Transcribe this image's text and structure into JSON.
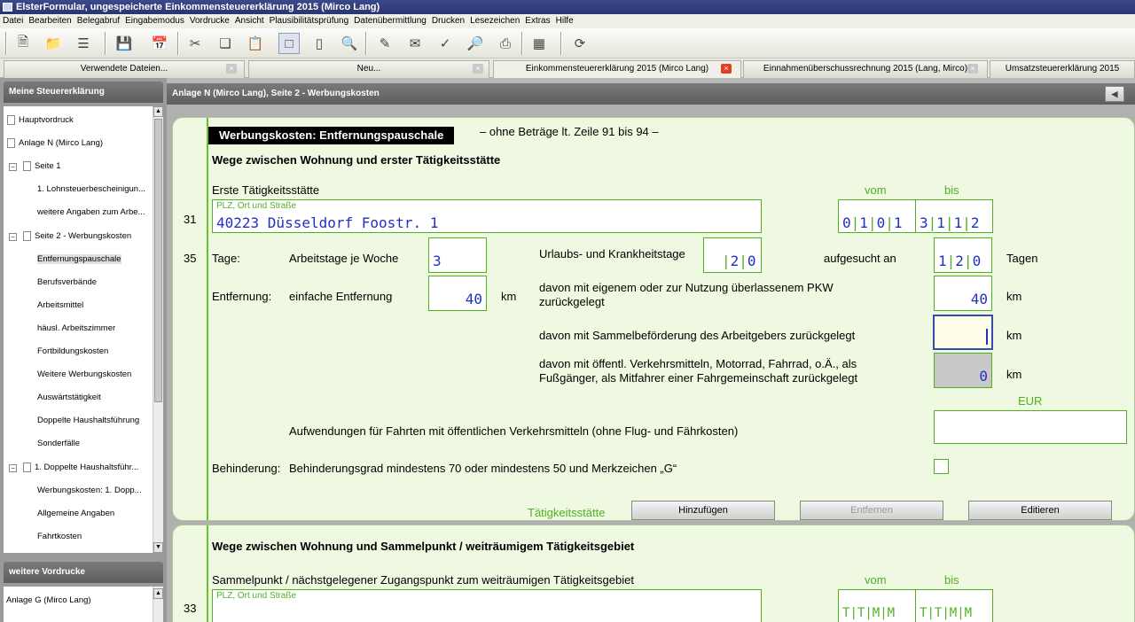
{
  "window": {
    "title": "ElsterFormular, ungespeicherte Einkommensteuererklärung 2015 (Mirco Lang)"
  },
  "menu": [
    "Datei",
    "Bearbeiten",
    "Belegabruf",
    "Eingabemodus",
    "Vordrucke",
    "Ansicht",
    "Plausibilitätsprüfung",
    "Datenübermittlung",
    "Drucken",
    "Lesezeichen",
    "Extras",
    "Hilfe"
  ],
  "toolbar": {
    "icons": [
      "new-document-icon",
      "open-folder-icon",
      "list-icon",
      "save-icon",
      "calendar-icon",
      "cut-icon",
      "copy-icon",
      "paste-icon",
      "form-view-icon",
      "page-view-icon",
      "search-icon",
      "edit-icon",
      "send-mail-icon",
      "check-icon",
      "print-preview-icon",
      "print-icon",
      "calculator-icon",
      "update-icon"
    ]
  },
  "tabs": [
    {
      "label": "Verwendete Dateien...",
      "close": "×"
    },
    {
      "label": "Neu...",
      "close": "×"
    },
    {
      "label": "Einkommensteuererklärung 2015 (Mirco Lang)",
      "close": "×"
    },
    {
      "label": "Einnahmenüberschussrechnung 2015 (Lang, Mirco)",
      "close": "×"
    },
    {
      "label": "Umsatzsteuererklärung 2015"
    }
  ],
  "sidebar": {
    "title": "Meine Steuererklärung",
    "items": [
      "Hauptvordruck",
      "Anlage N (Mirco Lang)",
      "Seite 1",
      "1. Lohnsteuerbescheinigun...",
      "weitere Angaben zum Arbe...",
      "Seite 2 - Werbungskosten",
      "Entfernungspauschale",
      "Berufsverbände",
      "Arbeitsmittel",
      "häusl. Arbeitszimmer",
      "Fortbildungskosten",
      "Weitere Werbungskosten",
      "Auswärtstätigkeit",
      "Doppelte Haushaltsführung",
      "Sonderfälle",
      "1. Doppelte Haushaltsführ...",
      "Werbungskosten: 1. Dopp...",
      "Allgemeine Angaben",
      "Fahrtkosten"
    ],
    "expander": "−",
    "scroll_up": "▲",
    "scroll_down": "▼",
    "more_title": "weitere Vordrucke",
    "more_items": [
      "Anlage G (Mirco Lang)"
    ]
  },
  "main": {
    "title": "Anlage N (Mirco Lang), Seite 2 - Werbungskosten",
    "nav_prev": "◀",
    "section_title": "Werbungskosten: Entfernungspauschale",
    "section_note": "– ohne Beträge lt. Zeile 91 bis 94 –",
    "heading1": "Wege zwischen Wohnung und erster Tätigkeitsstätte",
    "erste_label": "Erste Tätigkeitsstätte",
    "vom": "vom",
    "bis": "bis",
    "line31": "31",
    "plz_label": "PLZ, Ort und Straße",
    "address": "40223 Düsseldorf Foostr. 1",
    "vom_digits": [
      "0",
      "1",
      "0",
      "1"
    ],
    "bis_digits": [
      "3",
      "1",
      "1",
      "2"
    ],
    "line35": "35",
    "tage_label": "Tage:",
    "arbeitstage_label": "Arbeitstage je Woche",
    "arbeitstage_value": "3",
    "urlaub_label": "Urlaubs- und Krankheitstage",
    "urlaub_digits": [
      "2",
      "0"
    ],
    "aufgesucht_label": "aufgesucht an",
    "aufgesucht_digits": [
      "1",
      "2",
      "0"
    ],
    "tagen": "Tagen",
    "entfernung_label": "Entfernung:",
    "einfache_label": "einfache Entfernung",
    "einfache_value": "40",
    "km": "km",
    "pkw_label_1": "davon mit eigenem oder zur Nutzung überlassenem PKW",
    "pkw_label_2": "zurückgelegt",
    "pkw_value": "40",
    "sammel_label": "davon mit Sammelbeförderung des Arbeitgebers zurückgelegt",
    "oeff_label_1": "davon mit öffentl. Verkehrsmitteln, Motorrad, Fahrrad, o.Ä., als",
    "oeff_label_2": "Fußgänger, als Mitfahrer einer Fahrgemeinschaft zurückgelegt",
    "oeff_value": "0",
    "eur": "EUR",
    "aufwendungen_label": "Aufwendungen für Fahrten mit öffentlichen Verkehrsmitteln (ohne Flug- und Fährkosten)",
    "behinderung_label": "Behinderung:",
    "behinderung_text": "Behinderungsgrad mindestens 70 oder mindestens 50 und Merkzeichen „G“",
    "taetigkeit_label": "Tätigkeitsstätte",
    "btn_add": "Hinzufügen",
    "btn_remove": "Entfernen",
    "btn_edit": "Editieren",
    "heading2": "Wege zwischen Wohnung und Sammelpunkt / weiträumigem Tätigkeitsgebiet",
    "sammelpunkt_label": "Sammelpunkt / nächstgelegener Zugangspunkt zum weiträumigen Tätigkeitsgebiet",
    "line33": "33",
    "date_placeholder": [
      "T",
      "T",
      "M",
      "M"
    ]
  }
}
